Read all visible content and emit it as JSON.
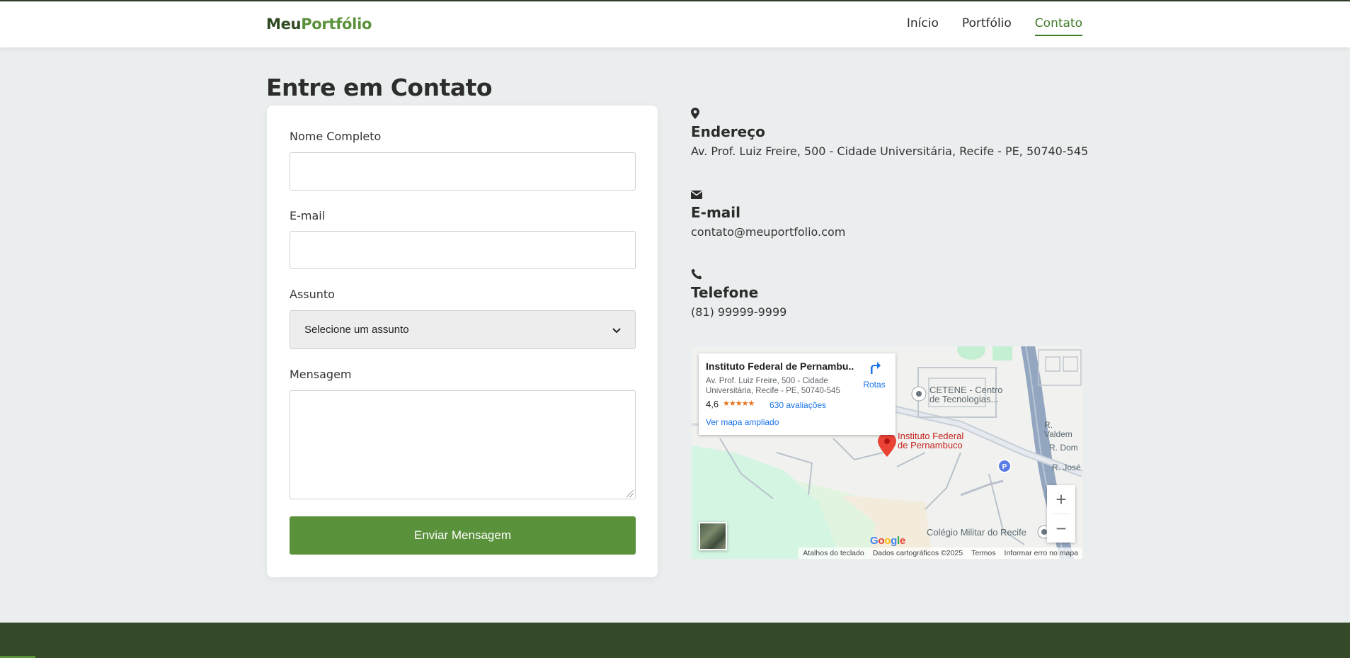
{
  "header": {
    "brand_part1": "Meu",
    "brand_part2": "Portfólio",
    "nav": [
      {
        "label": "Início"
      },
      {
        "label": "Portfólio"
      },
      {
        "label": "Contato"
      }
    ],
    "active_nav": "Contato"
  },
  "page": {
    "title": "Entre em Contato"
  },
  "form": {
    "name_label": "Nome Completo",
    "name_value": "",
    "email_label": "E-mail",
    "email_value": "",
    "subject_label": "Assunto",
    "subject_selected": "Selecione um assunto",
    "message_label": "Mensagem",
    "message_value": "",
    "submit_label": "Enviar Mensagem"
  },
  "contact": {
    "address": {
      "icon": "map-marker-icon",
      "title": "Endereço",
      "value": "Av. Prof. Luiz Freire, 500 - Cidade Universitária, Recife - PE, 50740-545"
    },
    "email": {
      "icon": "envelope-icon",
      "title": "E-mail",
      "value": "contato@meuportfolio.com"
    },
    "phone": {
      "icon": "phone-icon",
      "title": "Telefone",
      "value": "(81) 99999-9999"
    }
  },
  "map": {
    "place_name": "Instituto Federal de Pernambu...",
    "place_address": "Av. Prof. Luiz Freire, 500 - Cidade Universitária, Recife - PE, 50740-545",
    "rating": "4,6",
    "stars": "★★★★★",
    "reviews": "630 avaliações",
    "larger_map": "Ver mapa ampliado",
    "directions": "Rotas",
    "pin_label_1": "Instituto Federal",
    "pin_label_2": "de Pernambuco",
    "poi_cetene_1": "CETENE - Centro",
    "poi_cetene_2": "de Tecnologias...",
    "poi_colegio": "Colégio Militar do Recife",
    "street_1": "R. Valdem",
    "street_2": "R. Dom",
    "street_3": "R. José",
    "zoom_in": "+",
    "zoom_out": "−",
    "parking": "P",
    "footer_keyboard": "Atalhos do teclado",
    "footer_data": "Dados cartográficos ©2025",
    "footer_terms": "Termos",
    "footer_report": "Informar erro no mapa"
  },
  "colors": {
    "accent": "#5a913b",
    "dark_green": "#344a28",
    "background": "#ebeeee"
  }
}
